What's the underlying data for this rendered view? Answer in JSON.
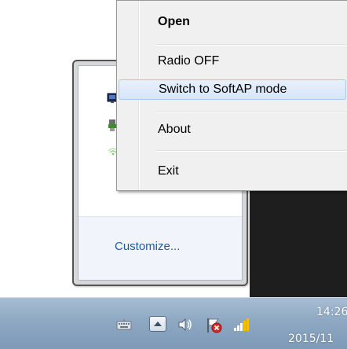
{
  "context_menu": {
    "items": [
      {
        "label": "Open",
        "bold": true
      },
      {
        "label": "Radio OFF"
      },
      {
        "label": "Switch to SoftAP mode",
        "highlighted": true
      },
      {
        "label": "About"
      },
      {
        "label": "Exit"
      }
    ]
  },
  "overflow_flyout": {
    "customize_label": "Customize...",
    "icons": [
      "network-app-icon",
      "usb-device-icon",
      "wifi-icon"
    ]
  },
  "taskbar": {
    "clock_time": "14:26",
    "clock_date": "2015/11",
    "tray_icons": [
      "keyboard-icon",
      "show-hidden-icons-button",
      "speaker-icon",
      "action-center-flag-icon",
      "network-signal-icon"
    ]
  },
  "colors": {
    "menu_background": "#f0f0f0",
    "menu_highlight": "#d6e6fb",
    "link": "#1e5aa0",
    "taskbar": "#8ea8c3"
  }
}
